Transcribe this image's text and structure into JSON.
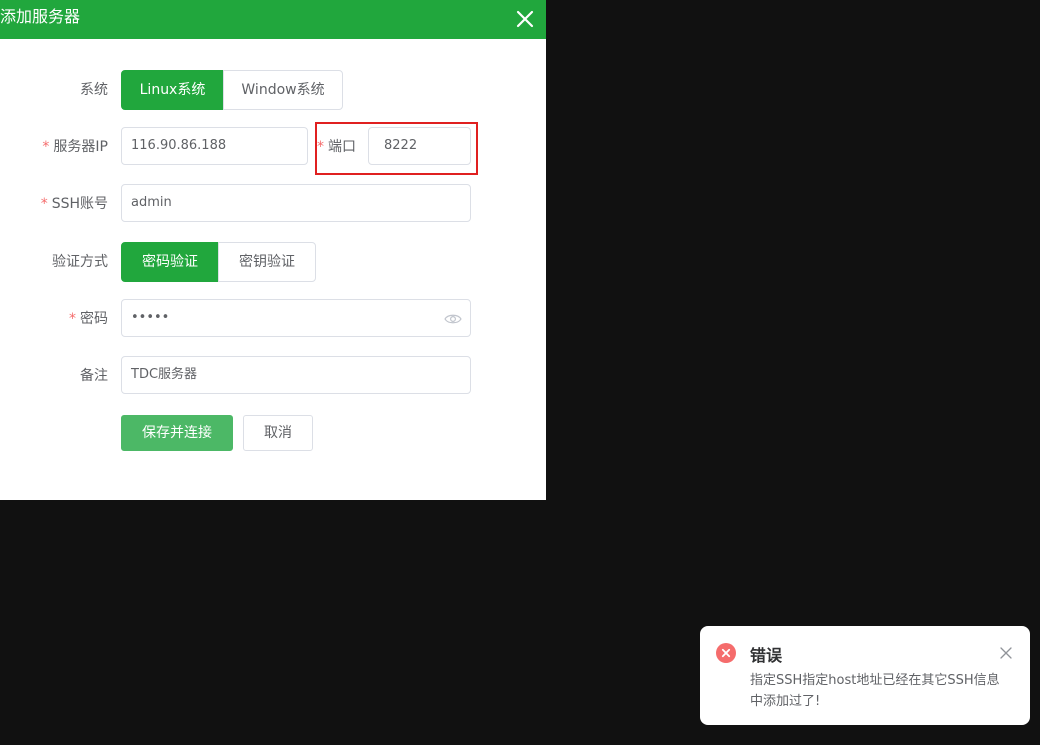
{
  "dialog": {
    "title": "添加服务器",
    "close_icon": "close-icon"
  },
  "form": {
    "system": {
      "label": "系统",
      "options": [
        "Linux系统",
        "Window系统"
      ],
      "selected": "Linux系统"
    },
    "server_ip": {
      "label": "服务器IP",
      "value": "116.90.86.188"
    },
    "port": {
      "label": "端口",
      "value": "8222"
    },
    "ssh_account": {
      "label": "SSH账号",
      "value": "admin"
    },
    "auth_method": {
      "label": "验证方式",
      "options": [
        "密码验证",
        "密钥验证"
      ],
      "selected": "密码验证"
    },
    "password": {
      "label": "密码",
      "value": "•••••",
      "toggle_icon": "eye-icon"
    },
    "remark": {
      "label": "备注",
      "value": "TDC服务器"
    },
    "required_mark": "*"
  },
  "actions": {
    "save_label": "保存并连接",
    "cancel_label": "取消"
  },
  "notification": {
    "title": "错误",
    "message": "指定SSH指定host地址已经在其它SSH信息中添加过了!",
    "icon": "error-icon",
    "close_icon": "close-icon"
  },
  "colors": {
    "primary": "#21a73d",
    "error": "#f56c6c",
    "highlight_border": "#e02020",
    "backdrop": "#111111"
  }
}
